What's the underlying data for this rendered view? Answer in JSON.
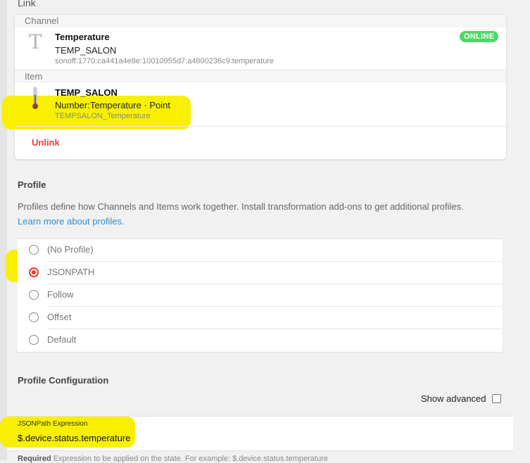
{
  "link": {
    "title": "Link",
    "channel_section": "Channel",
    "channel": {
      "icon": "T-letter-icon",
      "title": "Temperature",
      "item_name": "TEMP_SALON",
      "uid": "sonoff:1770:ca441a4e8e:10010955d7:a4800236c9:temperature",
      "status": "ONLINE"
    },
    "item_section": "Item",
    "item": {
      "icon": "thermometer-icon",
      "title": "TEMP_SALON",
      "type": "Number:Temperature · Point",
      "label": "TEMPSALON_Temperature"
    },
    "unlink_label": "Unlink"
  },
  "profile": {
    "heading": "Profile",
    "description": "Profiles define how Channels and Items work together. Install transformation add-ons to get additional profiles.",
    "learn_more": "Learn more about profiles.",
    "options": [
      {
        "label": "(No Profile)",
        "selected": false
      },
      {
        "label": "JSONPATH",
        "selected": true
      },
      {
        "label": "Follow",
        "selected": false
      },
      {
        "label": "Offset",
        "selected": false
      },
      {
        "label": "Default",
        "selected": false
      }
    ]
  },
  "config": {
    "heading": "Profile Configuration",
    "show_advanced": "Show advanced",
    "show_advanced_checked": false,
    "jsonpath_label": "JSONPath Expression",
    "jsonpath_value": "$.device.status.temperature",
    "required_word": "Required",
    "required_text": "Expression to be applied on the state. For example: $.device.status.temperature"
  },
  "colors": {
    "online": "#4cd964",
    "unlink": "#e53e3e",
    "radio_selected": "#ee3b1f",
    "link": "#2a8fd6",
    "highlight": "#f8f000"
  }
}
